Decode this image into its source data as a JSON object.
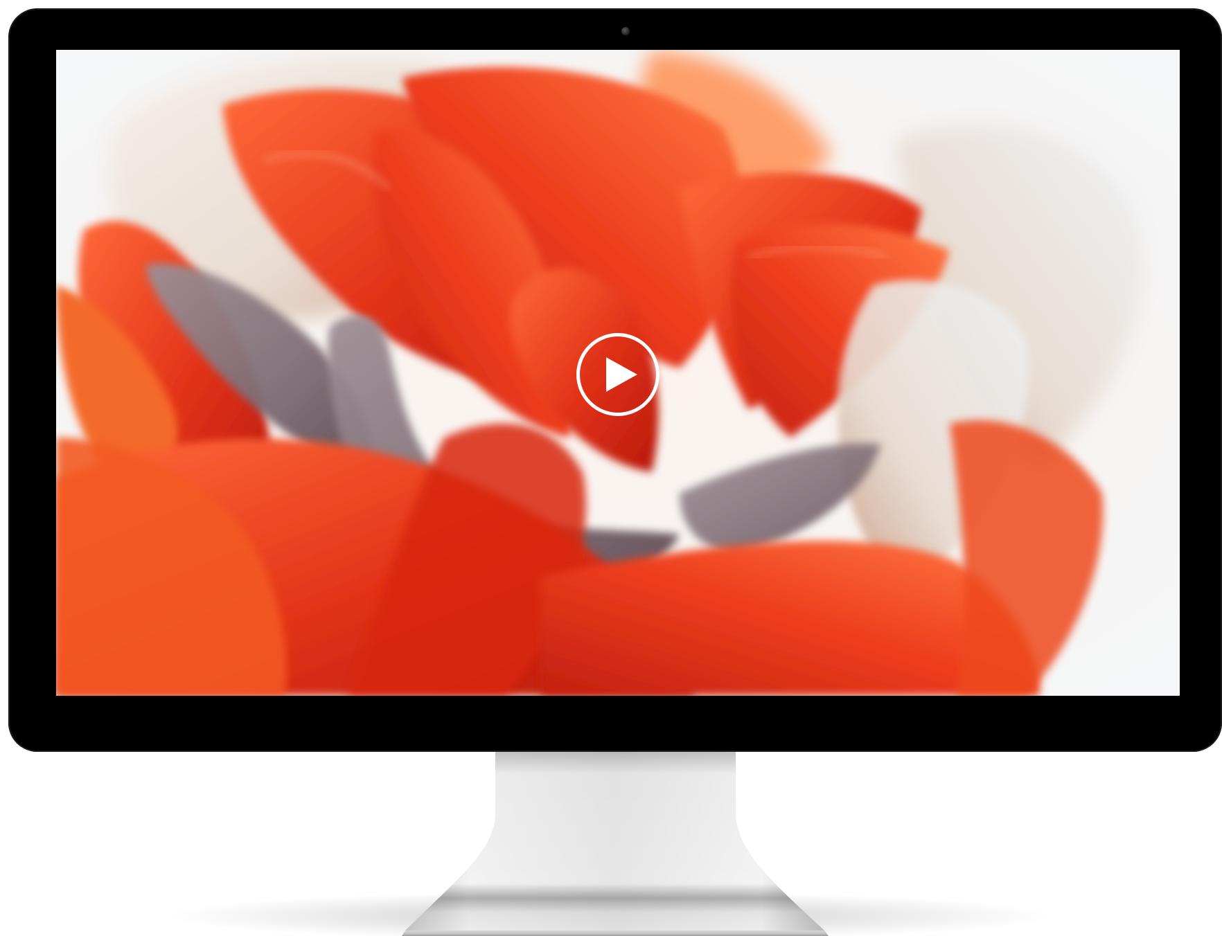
{
  "monitor": {
    "bezel_color": "#000000",
    "stand_color": "#d8d8d8"
  },
  "screen": {
    "content": "video-thumbnail",
    "subject_icon": "red-flower-image",
    "palette": {
      "petal_red": "#e8361a",
      "petal_orange": "#f36a2a",
      "petal_dark": "#b81d10",
      "petal_pale": "#f1e7df",
      "stamen_grey": "#8b7f86",
      "background": "#f7f5f3"
    }
  },
  "player": {
    "play_icon": "play-icon",
    "play_button_color": "#ffffff"
  }
}
